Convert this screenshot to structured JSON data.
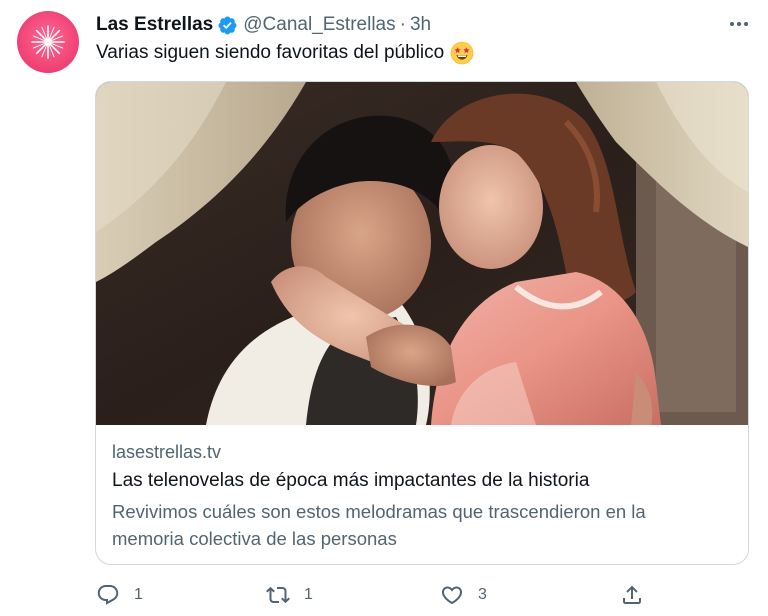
{
  "author": {
    "name": "Las Estrellas",
    "handle": "@Canal_Estrellas",
    "separator": "·",
    "time": "3h",
    "verified": true,
    "avatar_color": "#ef3f73"
  },
  "tweet": {
    "text": "Varias siguen siendo favoritas del público",
    "emoji": "star-struck-emoji"
  },
  "card": {
    "domain": "lasestrellas.tv",
    "title": "Las telenovelas de época más impactantes de la historia",
    "description": "Revivimos cuáles son estos melodramas que trascendieron en la memoria colectiva de las personas",
    "image": "photo-couple-embracing"
  },
  "actions": {
    "replies": "1",
    "retweets": "1",
    "likes": "3"
  },
  "colors": {
    "text_primary": "#0f1419",
    "text_secondary": "#536471",
    "verified_blue": "#1d9bf0",
    "border": "#cfd9de"
  }
}
